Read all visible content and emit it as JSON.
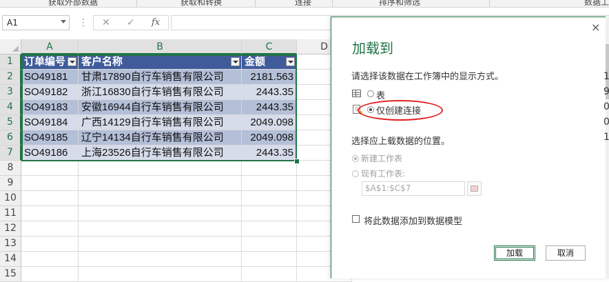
{
  "ribbon": {
    "groups": [
      "获取外部数据",
      "获取和转换",
      "连接",
      "排序和筛选",
      "数据工"
    ]
  },
  "formula_bar": {
    "name_box": "A1",
    "cancel_icon": "✕",
    "enter_icon": "✓",
    "function_label": "fx",
    "formula": ""
  },
  "sheet": {
    "columns": [
      "A",
      "B",
      "C",
      "D"
    ],
    "rows": [
      "1",
      "2",
      "3",
      "4",
      "5",
      "6",
      "7",
      "8",
      "9",
      "10",
      "11",
      "12",
      "13",
      "14",
      "15"
    ],
    "table": {
      "headers": [
        "订单编号",
        "客户名称",
        "金额"
      ],
      "rows": [
        [
          "SO49181",
          "甘肃17890自行车销售有限公司",
          "2181.563"
        ],
        [
          "SO49182",
          "浙江16830自行车销售有限公司",
          "2443.35"
        ],
        [
          "SO49183",
          "安徽16944自行车销售有限公司",
          "2443.35"
        ],
        [
          "SO49184",
          "广西14129自行车销售有限公司",
          "2049.098"
        ],
        [
          "SO49185",
          "辽宁14134自行车销售有限公司",
          "2049.098"
        ],
        [
          "SO49186",
          "上海23526自行车销售有限公司",
          "2443.35"
        ]
      ]
    }
  },
  "dialog": {
    "title": "加载到",
    "close": "×",
    "display_prompt": "请选择该数据在工作簿中的显示方式。",
    "option_table": "表",
    "option_connection_only": "仅创建连接",
    "location_prompt": "选择应上载数据的位置。",
    "option_new_sheet": "新建工作表",
    "option_existing_sheet": "现有工作表:",
    "range_value": "$A$1:$C$7",
    "add_to_model": "将此数据添加到数据模型",
    "load_button": "加载",
    "cancel_button": "取消"
  },
  "edge_text": [
    "1",
    "9",
    "0",
    "0",
    "1"
  ],
  "colors": {
    "accent": "#217346",
    "table_header": "#3f5b9a",
    "band_dark": "#b4bfd8",
    "band_light": "#d6dcea",
    "highlight_ring": "#e02020"
  }
}
